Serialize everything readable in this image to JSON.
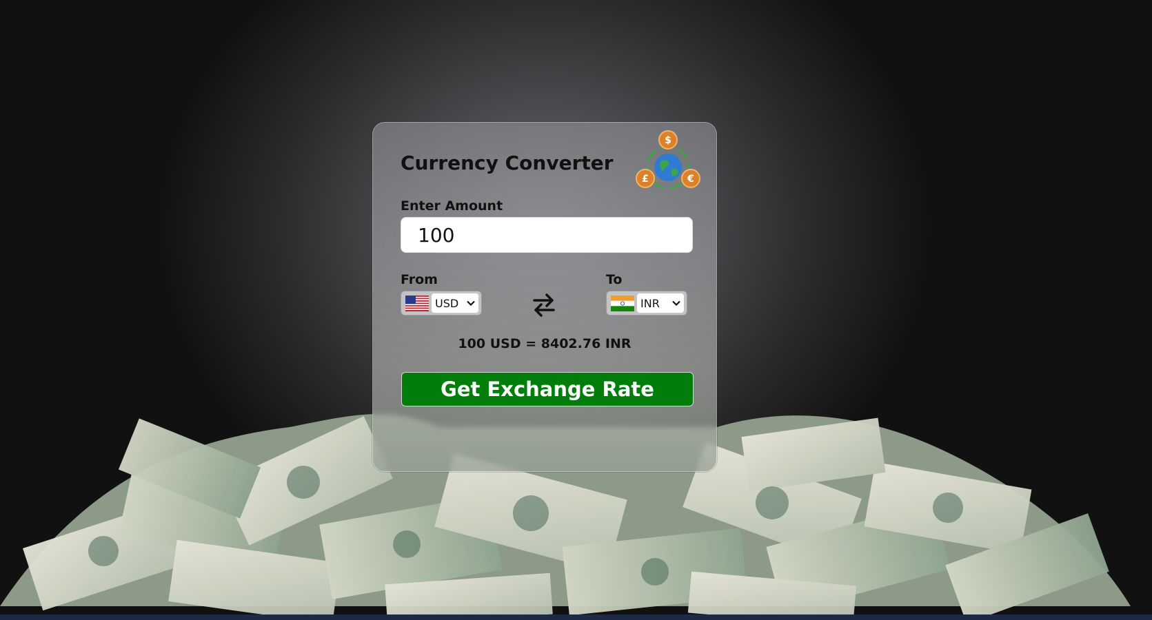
{
  "converter": {
    "title": "Currency Converter",
    "amount_label": "Enter Amount",
    "amount_value": "100",
    "from_label": "From",
    "to_label": "To",
    "from_currency": "USD",
    "to_currency": "INR",
    "result_text": "100 USD = 8402.76 INR",
    "button_label": "Get Exchange Rate",
    "logo_symbols": [
      "$",
      "£",
      "€"
    ]
  },
  "icons": {
    "swap": "swap-arrows-icon",
    "logo": "globe-currency-logo",
    "from_flag": "us-flag-icon",
    "to_flag": "india-flag-icon",
    "dropdown": "chevron-down-icon"
  },
  "colors": {
    "button_bg": "#007d0a",
    "button_text": "#ffffff",
    "coin": "#d9822b"
  }
}
